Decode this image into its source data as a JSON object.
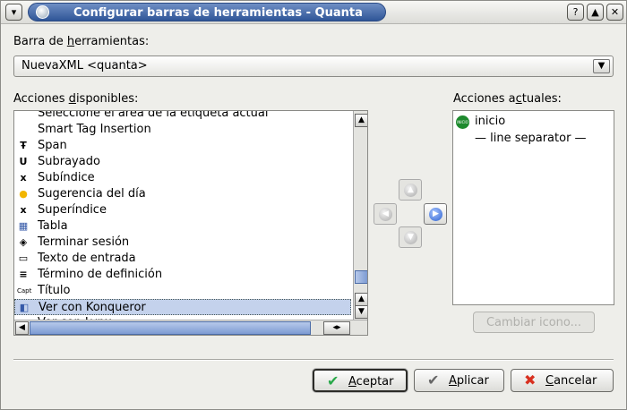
{
  "window": {
    "title": "Configurar barras de herramientas - Quanta",
    "menu_glyph": "▾",
    "help_glyph": "?",
    "max_glyph": "▲",
    "close_glyph": "✕"
  },
  "toolbar_label_prefix": "Barra de ",
  "toolbar_label_accel": "h",
  "toolbar_label_suffix": "erramientas:",
  "toolbar_select": {
    "value": "NuevaXML <quanta>",
    "arrow": "▼"
  },
  "available": {
    "label_prefix": "Acciones ",
    "label_accel": "d",
    "label_suffix": "isponibles:",
    "items": [
      {
        "icon": "",
        "icon_name": "select-tag-area-icon",
        "text": "Seleccione el área de la etiqueta actual"
      },
      {
        "icon": "",
        "icon_name": "blank-icon",
        "text": "Smart Tag Insertion"
      },
      {
        "icon": "Ŧ",
        "icon_name": "span-icon",
        "text": "Span"
      },
      {
        "icon": "U",
        "icon_name": "underline-icon",
        "text": "Subrayado"
      },
      {
        "icon": "x",
        "icon_name": "subscript-icon",
        "text": "Subíndice"
      },
      {
        "icon": "●",
        "icon_name": "lightbulb-icon",
        "text": "Sugerencia del día"
      },
      {
        "icon": "x",
        "icon_name": "superscript-icon",
        "text": "Superíndice"
      },
      {
        "icon": "▦",
        "icon_name": "table-icon",
        "text": "Tabla"
      },
      {
        "icon": "◈",
        "icon_name": "logout-icon",
        "text": "Terminar sesión"
      },
      {
        "icon": "▭",
        "icon_name": "text-input-icon",
        "text": "Texto de entrada"
      },
      {
        "icon": "≡",
        "icon_name": "definition-term-icon",
        "text": "Término de definición"
      },
      {
        "icon": "Capt",
        "icon_name": "caption-icon",
        "text": "Título"
      },
      {
        "icon": "◧",
        "icon_name": "konqueror-icon",
        "text": "Ver con Konqueror"
      },
      {
        "icon": "▬",
        "icon_name": "lynx-icon",
        "text": "Ver con Lynx"
      }
    ],
    "selected_index": 12
  },
  "current": {
    "label_prefix": "Acciones a",
    "label_accel": "c",
    "label_suffix": "tuales:",
    "items": [
      {
        "icon": "INICIO",
        "icon_name": "start-icon",
        "text": "inicio"
      },
      {
        "icon": "",
        "icon_name": "separator-icon",
        "text": "— line separator —"
      }
    ]
  },
  "move_buttons": {
    "up": "▲",
    "left": "◀",
    "right": "▶",
    "down": "▼"
  },
  "change_icon_label": "Cambiar icono...",
  "scroll_glyphs": {
    "up": "▲",
    "down": "▼",
    "left": "◀",
    "right": "▶",
    "leftright": "◂▸"
  },
  "buttons": {
    "accept": {
      "icon": "✔",
      "accel": "A",
      "rest": "ceptar"
    },
    "apply": {
      "icon": "✔",
      "accel": "A",
      "rest": "plicar"
    },
    "cancel": {
      "icon": "✖",
      "accel": "C",
      "rest": "ancelar"
    }
  },
  "colors": {
    "title_bar": "#2f5597",
    "selection": "#c4d2ec",
    "ok_icon": "#2aa84a",
    "cancel_icon": "#d83020",
    "start_icon": "#1e8a2e"
  }
}
